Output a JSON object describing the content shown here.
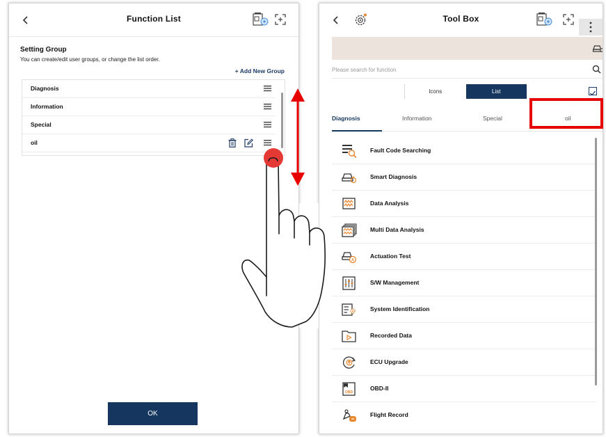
{
  "left": {
    "title": "Function List",
    "setting_group_title": "Setting Group",
    "setting_group_desc": "You can create/edit user groups, or change the list order.",
    "add_group_label": "+ Add New Group",
    "groups": [
      {
        "label": "Diagnosis"
      },
      {
        "label": "Information"
      },
      {
        "label": "Special"
      },
      {
        "label": "oil"
      }
    ],
    "ok_label": "OK"
  },
  "right": {
    "title": "Tool Box",
    "search_placeholder": "Please search for function",
    "view_options": [
      "Icons",
      "List"
    ],
    "selected_view": "List",
    "tabs": [
      "Diagnosis",
      "Information",
      "Special",
      "oil"
    ],
    "active_tab": "Diagnosis",
    "functions": [
      {
        "label": "Fault Code Searching",
        "icon": "fault-code-icon"
      },
      {
        "label": "Smart Diagnosis",
        "icon": "smart-diagnosis-icon"
      },
      {
        "label": "Data Analysis",
        "icon": "data-analysis-icon"
      },
      {
        "label": "Multi Data Analysis",
        "icon": "multi-data-icon"
      },
      {
        "label": "Actuation Test",
        "icon": "actuation-test-icon"
      },
      {
        "label": "S/W Management",
        "icon": "sw-management-icon"
      },
      {
        "label": "System Identification",
        "icon": "system-id-icon"
      },
      {
        "label": "Recorded Data",
        "icon": "recorded-data-icon"
      },
      {
        "label": "ECU Upgrade",
        "icon": "ecu-upgrade-icon"
      },
      {
        "label": "OBD-II",
        "icon": "obd-icon"
      },
      {
        "label": "Flight Record",
        "icon": "flight-record-icon"
      }
    ]
  },
  "colors": {
    "primary": "#14365f",
    "accent_orange": "#e8862d",
    "highlight_red": "#e60000",
    "banner": "#ebe3dc"
  }
}
